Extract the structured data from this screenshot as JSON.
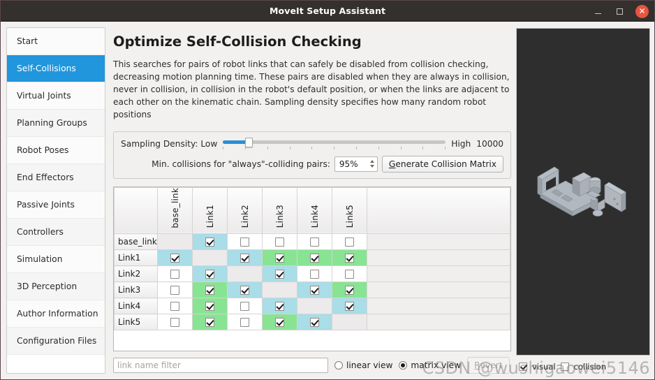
{
  "window": {
    "title": "MoveIt Setup Assistant",
    "minimize_label": "–",
    "maximize_label": "□",
    "close_label": "✕"
  },
  "sidebar": {
    "items": [
      {
        "label": "Start",
        "selected": false
      },
      {
        "label": "Self-Collisions",
        "selected": true
      },
      {
        "label": "Virtual Joints",
        "selected": false
      },
      {
        "label": "Planning Groups",
        "selected": false
      },
      {
        "label": "Robot Poses",
        "selected": false
      },
      {
        "label": "End Effectors",
        "selected": false
      },
      {
        "label": "Passive Joints",
        "selected": false
      },
      {
        "label": "Controllers",
        "selected": false
      },
      {
        "label": "Simulation",
        "selected": false
      },
      {
        "label": "3D Perception",
        "selected": false
      },
      {
        "label": "Author Information",
        "selected": false
      },
      {
        "label": "Configuration Files",
        "selected": false
      }
    ]
  },
  "main": {
    "title": "Optimize Self-Collision Checking",
    "description": "This searches for pairs of robot links that can safely be disabled from collision checking, decreasing motion planning time. These pairs are disabled when they are always in collision, never in collision, in collision in the robot's default position, or when the links are adjacent to each other on the kinematic chain. Sampling density specifies how many random robot positions",
    "sampling": {
      "label": "Sampling Density: Low",
      "low_label": "Low",
      "high_label": "High",
      "value_label": "10000",
      "slider_percent": 10,
      "min_collisions_label": "Min. collisions for \"always\"-colliding pairs:",
      "percent_value": "95%",
      "generate_button_mnemonic": "G",
      "generate_button_rest": "enerate Collision Matrix"
    },
    "matrix": {
      "columns": [
        "base_link",
        "Link1",
        "Link2",
        "Link3",
        "Link4",
        "Link5"
      ],
      "rows": [
        {
          "label": "base_link",
          "cells": [
            {
              "state": "diagonal",
              "checked": false,
              "color": "blue"
            },
            {
              "state": "blue",
              "checked": true,
              "color": "blue"
            },
            {
              "state": "plain",
              "checked": false,
              "color": "none"
            },
            {
              "state": "plain",
              "checked": false,
              "color": "none"
            },
            {
              "state": "plain",
              "checked": false,
              "color": "none"
            },
            {
              "state": "plain",
              "checked": false,
              "color": "none"
            }
          ]
        },
        {
          "label": "Link1",
          "cells": [
            {
              "state": "blue",
              "checked": true,
              "color": "blue"
            },
            {
              "state": "diagonal",
              "checked": false,
              "color": "none"
            },
            {
              "state": "blue",
              "checked": true,
              "color": "blue"
            },
            {
              "state": "green",
              "checked": true,
              "color": "green"
            },
            {
              "state": "green",
              "checked": true,
              "color": "green"
            },
            {
              "state": "green",
              "checked": true,
              "color": "green"
            }
          ]
        },
        {
          "label": "Link2",
          "cells": [
            {
              "state": "plain",
              "checked": false,
              "color": "none"
            },
            {
              "state": "blue",
              "checked": true,
              "color": "blue"
            },
            {
              "state": "diagonal",
              "checked": false,
              "color": "none"
            },
            {
              "state": "blue",
              "checked": true,
              "color": "blue"
            },
            {
              "state": "plain",
              "checked": false,
              "color": "none"
            },
            {
              "state": "plain",
              "checked": false,
              "color": "none"
            }
          ]
        },
        {
          "label": "Link3",
          "cells": [
            {
              "state": "plain",
              "checked": false,
              "color": "none"
            },
            {
              "state": "green",
              "checked": true,
              "color": "green"
            },
            {
              "state": "blue",
              "checked": true,
              "color": "blue"
            },
            {
              "state": "diagonal",
              "checked": false,
              "color": "none"
            },
            {
              "state": "blue",
              "checked": true,
              "color": "blue"
            },
            {
              "state": "green",
              "checked": true,
              "color": "green"
            }
          ]
        },
        {
          "label": "Link4",
          "cells": [
            {
              "state": "plain",
              "checked": false,
              "color": "none"
            },
            {
              "state": "green",
              "checked": true,
              "color": "green"
            },
            {
              "state": "plain",
              "checked": false,
              "color": "none"
            },
            {
              "state": "blue",
              "checked": true,
              "color": "blue"
            },
            {
              "state": "diagonal",
              "checked": false,
              "color": "none"
            },
            {
              "state": "blue",
              "checked": true,
              "color": "blue"
            }
          ]
        },
        {
          "label": "Link5",
          "cells": [
            {
              "state": "plain",
              "checked": false,
              "color": "none"
            },
            {
              "state": "green",
              "checked": true,
              "color": "green"
            },
            {
              "state": "plain",
              "checked": false,
              "color": "none"
            },
            {
              "state": "green",
              "checked": true,
              "color": "green"
            },
            {
              "state": "blue",
              "checked": true,
              "color": "blue"
            },
            {
              "state": "diagonal",
              "checked": false,
              "color": "none"
            }
          ]
        }
      ]
    },
    "bottom": {
      "filter_placeholder": "link name filter",
      "filter_value": "",
      "linear_view_label": "linear view",
      "matrix_view_label": "matrix view",
      "selected_view": "matrix view",
      "revert_mnemonic": "R",
      "revert_rest": "evert",
      "revert_disabled": true
    }
  },
  "right_panel": {
    "visual_label": "visual",
    "visual_checked": true,
    "collision_label": "collision",
    "collision_checked": false,
    "viewport_background": "#2e2e2e"
  },
  "watermark": {
    "text": "CSDN @wushigaowei5146"
  },
  "colors": {
    "accent": "#2196dd",
    "cell_blue": "#a9dde8",
    "cell_green": "#88e493",
    "cell_diagonal": "#eceaea",
    "titlebar": "#34302d",
    "close_button": "#e8543f"
  }
}
